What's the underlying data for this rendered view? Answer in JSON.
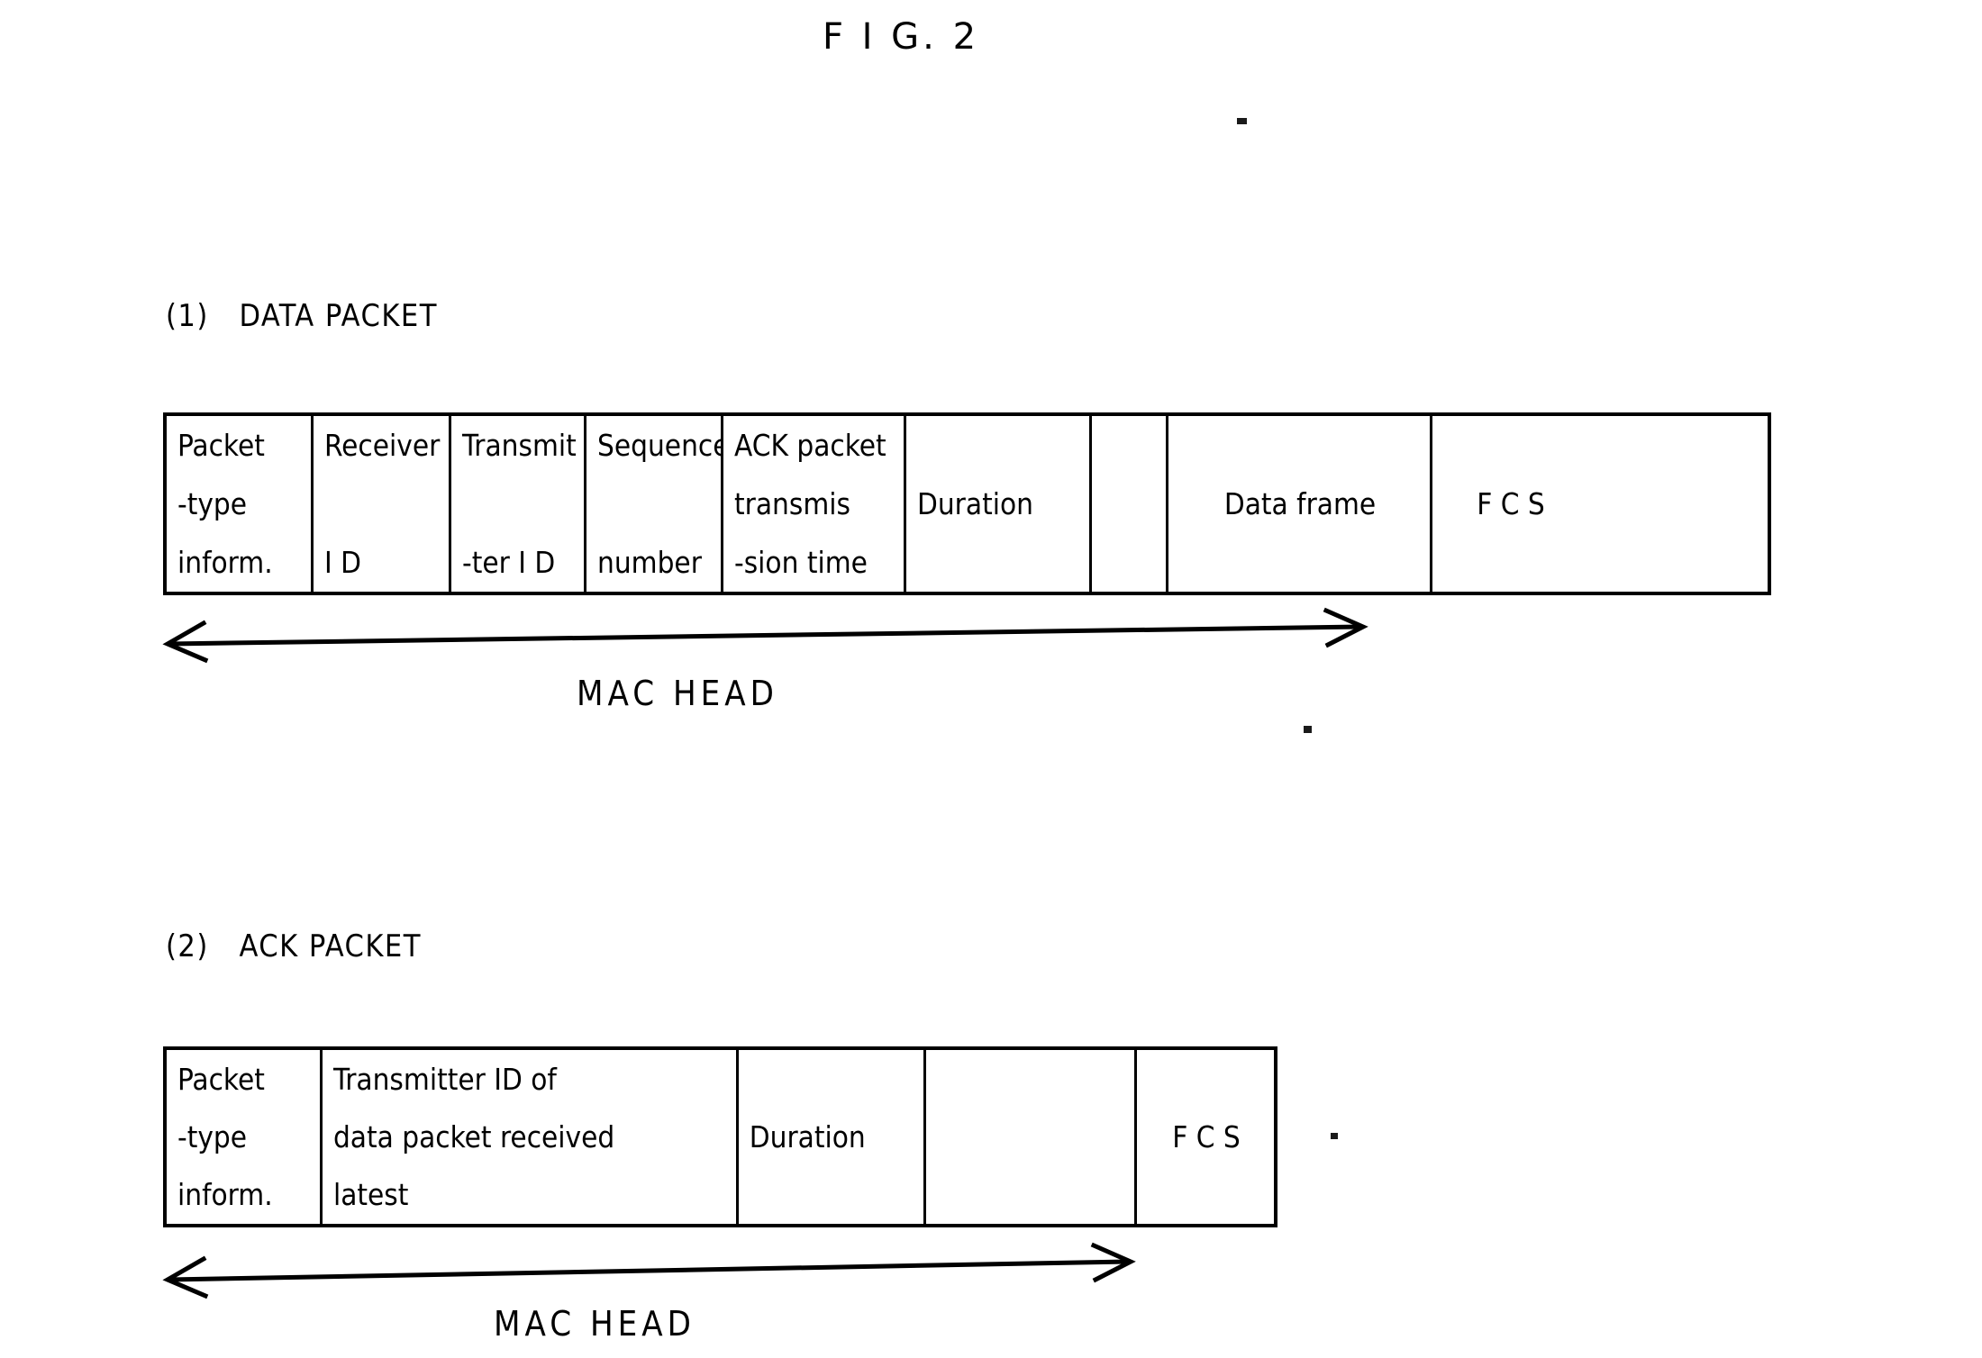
{
  "figure": {
    "title": "F I G. 2"
  },
  "sections": [
    {
      "label": "(1)   DATA PACKET",
      "caption": "MAC HEAD",
      "cells": [
        {
          "name": "packet-type-information",
          "lines": [
            "Packet",
            "-type",
            "inform."
          ]
        },
        {
          "name": "receiver-id",
          "lines": [
            "Receiver",
            "I D"
          ]
        },
        {
          "name": "transmitter-id",
          "lines": [
            "Transmit",
            "-ter I D"
          ]
        },
        {
          "name": "sequence-number",
          "lines": [
            "Sequence",
            "number"
          ]
        },
        {
          "name": "ack-packet-transmission-time",
          "lines": [
            "ACK packet",
            "transmis",
            "-sion time"
          ]
        },
        {
          "name": "duration",
          "lines": [
            "Duration"
          ]
        },
        {
          "name": "unlabeled-field",
          "lines": []
        },
        {
          "name": "data-frame",
          "lines": [
            "Data frame"
          ]
        },
        {
          "name": "fcs",
          "lines": [
            "F C S"
          ]
        }
      ]
    },
    {
      "label": "(2)   ACK PACKET",
      "caption": "MAC HEAD",
      "cells": [
        {
          "name": "packet-type-information",
          "lines": [
            "Packet",
            "-type",
            "inform."
          ]
        },
        {
          "name": "transmitter-id-of-latest-data-packet",
          "lines": [
            "Transmitter ID of",
            "data packet received",
            "latest"
          ]
        },
        {
          "name": "duration",
          "lines": [
            "Duration"
          ]
        },
        {
          "name": "unlabeled-field",
          "lines": []
        },
        {
          "name": "fcs",
          "lines": [
            "F C S"
          ]
        }
      ]
    }
  ],
  "colors": {
    "ink": "#000000",
    "paper": "#ffffff"
  }
}
